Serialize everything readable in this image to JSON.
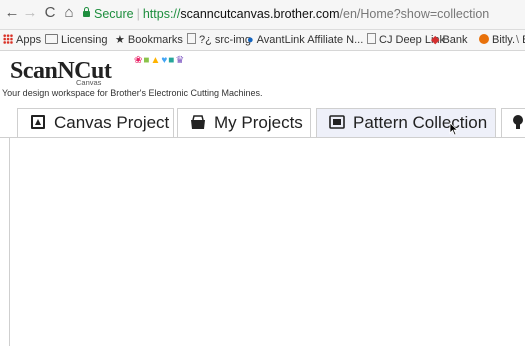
{
  "browser": {
    "nav": {
      "back": "←",
      "forward": "→",
      "reload": "C",
      "home": "⌂"
    },
    "security_label": "Secure",
    "url": {
      "protocol": "https://",
      "host": "scanncutcanvas.brother.com",
      "path": "/en/Home?show=collection"
    },
    "bookmarks": [
      {
        "label": "Apps",
        "icon": "apps-grid-icon"
      },
      {
        "label": "Licensing",
        "icon": "folder-icon"
      },
      {
        "label": "Bookmarks",
        "icon": "star-icon"
      },
      {
        "label": "?¿ src-img",
        "icon": "document-icon"
      },
      {
        "label": "AvantLink Affiliate N...",
        "icon": "avantlink-icon"
      },
      {
        "label": "CJ Deep Link",
        "icon": "document-icon"
      },
      {
        "label": "Bank",
        "icon": "bank-icon"
      },
      {
        "label": "Bitly.",
        "icon": "bitly-icon"
      },
      {
        "label": "B",
        "icon": "rss-icon"
      }
    ]
  },
  "site": {
    "logo_text": "ScanNCut",
    "logo_subtext": "Canvas",
    "tagline": "Your design workspace for Brother's Electronic Cutting Machines."
  },
  "tabs": [
    {
      "label": "Canvas Project",
      "icon": "canvas-project-icon",
      "active": false
    },
    {
      "label": "My Projects",
      "icon": "my-projects-icon",
      "active": false
    },
    {
      "label": "Pattern Collection",
      "icon": "pattern-collection-icon",
      "active": true
    },
    {
      "label": "",
      "icon": "partial-tab-icon",
      "active": false
    }
  ],
  "colors": {
    "active_tab": "#eef0f9",
    "secure_green": "#1e8e3e"
  }
}
